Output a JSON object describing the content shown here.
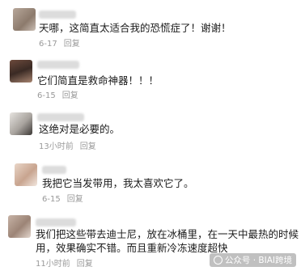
{
  "comments": [
    {
      "text": "天哪，这简直太适合我的恐慌症了！谢谢！",
      "date": "6-17",
      "reply": "回复"
    },
    {
      "text": "它们简直是救命神器！！！",
      "date": "6-15",
      "reply": "回复"
    },
    {
      "text": "这绝对是必要的。",
      "date": "13小时前",
      "reply": "回复"
    },
    {
      "text": "我把它当发带用，我太喜欢它了。",
      "date": "6-15",
      "reply": "回复"
    },
    {
      "text_line1": "我们把这些带去迪士尼，放在冰桶里，在一天中最热的时候",
      "text_line2": "用，效果确实不错。而且重新冷冻速度超快",
      "date": "11小时前",
      "reply": "回复"
    }
  ],
  "watermark": "公众号 · BIAI跨境"
}
